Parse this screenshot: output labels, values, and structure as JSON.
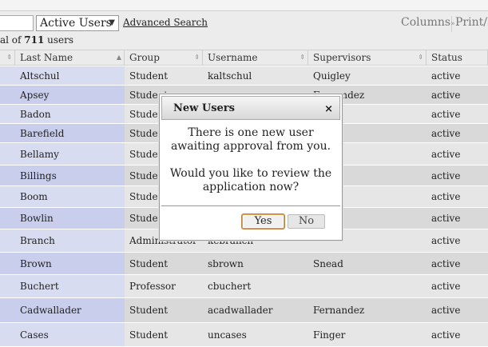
{
  "toolbar": {
    "filter_selected": "Active Users",
    "advanced_search_label": "Advanced Search",
    "columns_label": "Columns",
    "columns_arrow": "»",
    "print_label": "Print/E"
  },
  "summary": {
    "prefix": "al of ",
    "total": "711",
    "suffix": " users"
  },
  "table": {
    "headers": [
      "",
      "Last Name",
      "Group",
      "Username",
      "Supervisors",
      "Status"
    ],
    "rows": [
      [
        "",
        "Altschul",
        "Student",
        "kaltschul",
        "Quigley",
        "active"
      ],
      [
        "",
        "Apsey",
        "Student",
        "",
        "Fernandez",
        "active"
      ],
      [
        "",
        "Badon",
        "Student",
        "",
        "",
        "active"
      ],
      [
        "",
        "Barefield",
        "Student",
        "",
        "",
        "active"
      ],
      [
        "",
        "Bellamy",
        "Student",
        "",
        "",
        "active"
      ],
      [
        "",
        "Billings",
        "Student",
        "",
        "",
        "active"
      ],
      [
        "",
        "Boom",
        "Student",
        "",
        "",
        "active"
      ],
      [
        "",
        "Bowlin",
        "Student",
        "",
        "",
        "active"
      ],
      [
        "",
        "Branch",
        "Administrator",
        "kebranch",
        "",
        "active"
      ],
      [
        "",
        "Brown",
        "Student",
        "sbrown",
        "Snead",
        "active"
      ],
      [
        "",
        "Buchert",
        "Professor",
        "cbuchert",
        "",
        "active"
      ],
      [
        "",
        "Cadwallader",
        "Student",
        "acadwallader",
        "Fernandez",
        "active"
      ],
      [
        "",
        "Cases",
        "Student",
        "uncases",
        "Finger",
        "active"
      ]
    ]
  },
  "modal": {
    "title": "New Users",
    "close_glyph": "×",
    "message_line1": "There is one new user awaiting approval from you.",
    "message_line2": "Would you like to review the application now?",
    "yes_label": "Yes",
    "no_label": "No"
  },
  "colors": {
    "row_light": "#e6e6e6",
    "row_dark": "#d9d9d9",
    "row_sorted_col_light": "#d8dcf0",
    "row_sorted_col_dark": "#c9ceec",
    "accent": "#e0a050"
  }
}
